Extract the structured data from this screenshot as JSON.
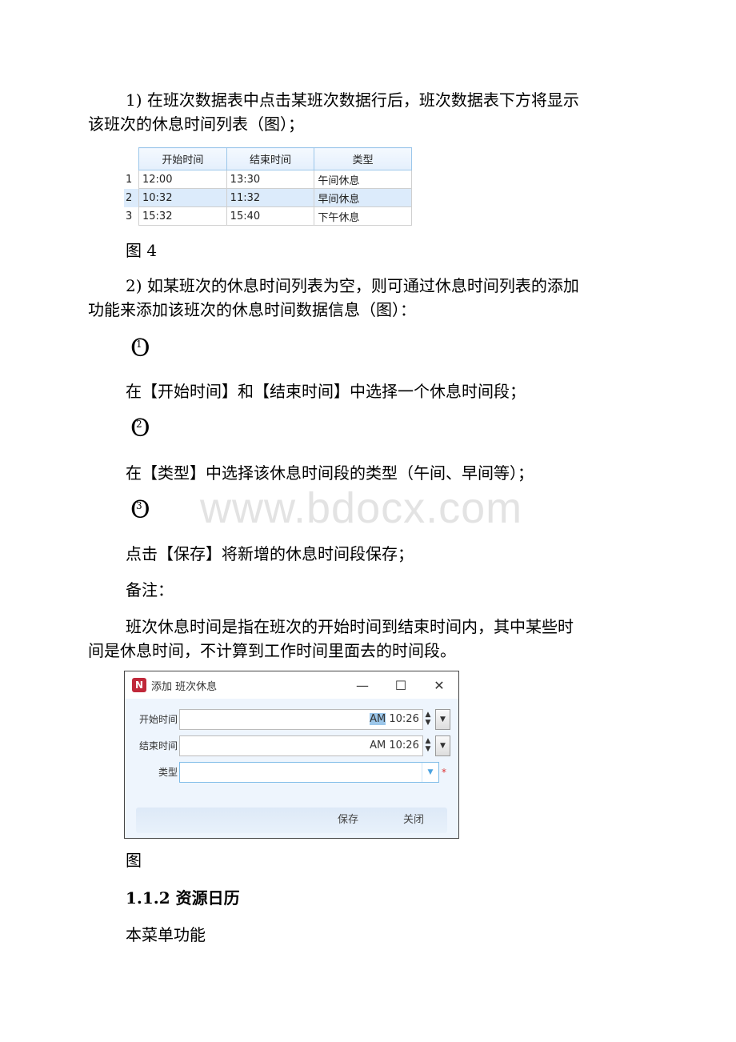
{
  "paragraphs": {
    "p1_line1": "1) 在班次数据表中点击某班次数据行后，班次数据表下方将显示",
    "p1_line2": "该班次的休息时间列表（图）；",
    "fig4_caption": "图 4",
    "p2_line1": "2) 如某班次的休息时间列表为空，则可通过休息时间列表的添加",
    "p2_line2": "功能来添加该班次的休息时间数据信息（图）：",
    "step1": "在【开始时间】和【结束时间】中选择一个休息时间段；",
    "step2": "在【类型】中选择该休息时间段的类型（午间、早间等）；",
    "step3": "点击【保存】将新增的休息时间段保存；",
    "note_label": "备注：",
    "note_line1": "班次休息时间是指在班次的开始时间到结束时间内，其中某些时",
    "note_line2": "间是休息时间，不计算到工作时间里面去的时间段。",
    "fig_caption": "图",
    "heading": "1.1.2 资源日历",
    "last_line": "本菜单功能"
  },
  "bullets": [
    {
      "glyph": "O",
      "num": "1"
    },
    {
      "glyph": "O",
      "num": "2"
    },
    {
      "glyph": "O",
      "num": "3"
    }
  ],
  "watermark": "www.bdocx.com",
  "break_table": {
    "columns": [
      "开始时间",
      "结束时间",
      "类型"
    ],
    "rows": [
      {
        "n": "1",
        "start": "12:00",
        "end": "13:30",
        "type": "午间休息"
      },
      {
        "n": "2",
        "start": "10:32",
        "end": "11:32",
        "type": "早间休息",
        "selected": true
      },
      {
        "n": "3",
        "start": "15:32",
        "end": "15:40",
        "type": "下午休息"
      }
    ]
  },
  "dialog": {
    "app_icon": "N",
    "title": "添加 班次休息",
    "minimize": "—",
    "maximize": "☐",
    "close": "✕",
    "start_label": "开始时间",
    "start_ampm": "AM",
    "start_time": " 10:26",
    "end_label": "结束时间",
    "end_value": "AM 10:26",
    "type_label": "类型",
    "type_value": "",
    "required_mark": "*",
    "spin_up": "▲",
    "spin_down": "▼",
    "dropdown": "▼",
    "save": "保存",
    "close_btn": "关闭"
  }
}
